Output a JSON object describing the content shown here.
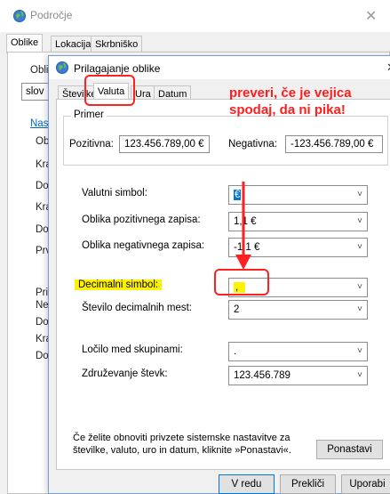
{
  "outer": {
    "title": "Področje",
    "close": "✕",
    "tabs": [
      "Oblike",
      "Lokacija",
      "Skrbniško"
    ],
    "bg_labels": [
      "Oblik",
      "slov",
      "Nast",
      "Ob",
      "Kra",
      "Do",
      "Kra",
      "Do",
      "Prv",
      "Pri",
      "Ne",
      "Do",
      "Kra",
      "Do"
    ]
  },
  "dialog": {
    "title": "Prilagajanje oblike",
    "close": "✕",
    "tabs": [
      "Številke",
      "Valuta",
      "Ura",
      "Datum"
    ],
    "example": {
      "group_label": "Primer",
      "positive_label": "Pozitivna:",
      "positive_value": "123.456.789,00 €",
      "negative_label": "Negativna:",
      "negative_value": "-123.456.789,00 €"
    },
    "fields": {
      "currency_symbol": {
        "label": "Valutni simbol:",
        "value": "€"
      },
      "positive_format": {
        "label": "Oblika pozitivnega zapisa:",
        "value": "1,1 €"
      },
      "negative_format": {
        "label": "Oblika negativnega zapisa:",
        "value": "-1,1 €"
      },
      "decimal_symbol": {
        "label": "Decimalni simbol:",
        "value": ","
      },
      "decimal_digits": {
        "label": "Število decimalnih mest:",
        "value": "2"
      },
      "group_separator": {
        "label": "Ločilo med skupinami:",
        "value": "."
      },
      "digit_grouping": {
        "label": "Združevanje števk:",
        "value": "123.456.789"
      }
    },
    "reset_text": "Če želite obnoviti privzete sistemske nastavitve za številke, valuto, uro in datum, kliknite »Ponastavi«.",
    "buttons": {
      "reset": "Ponastavi",
      "ok": "V redu",
      "cancel": "Prekliči",
      "apply": "Uporabi"
    }
  },
  "annotation": {
    "text": "preveri, če je vejica spodaj, da ni pika!",
    "color": "#ff1e1e",
    "highlight": "#fff200"
  },
  "icons": {
    "chevron": "chevron-down-icon",
    "app": "region-globe-icon"
  }
}
